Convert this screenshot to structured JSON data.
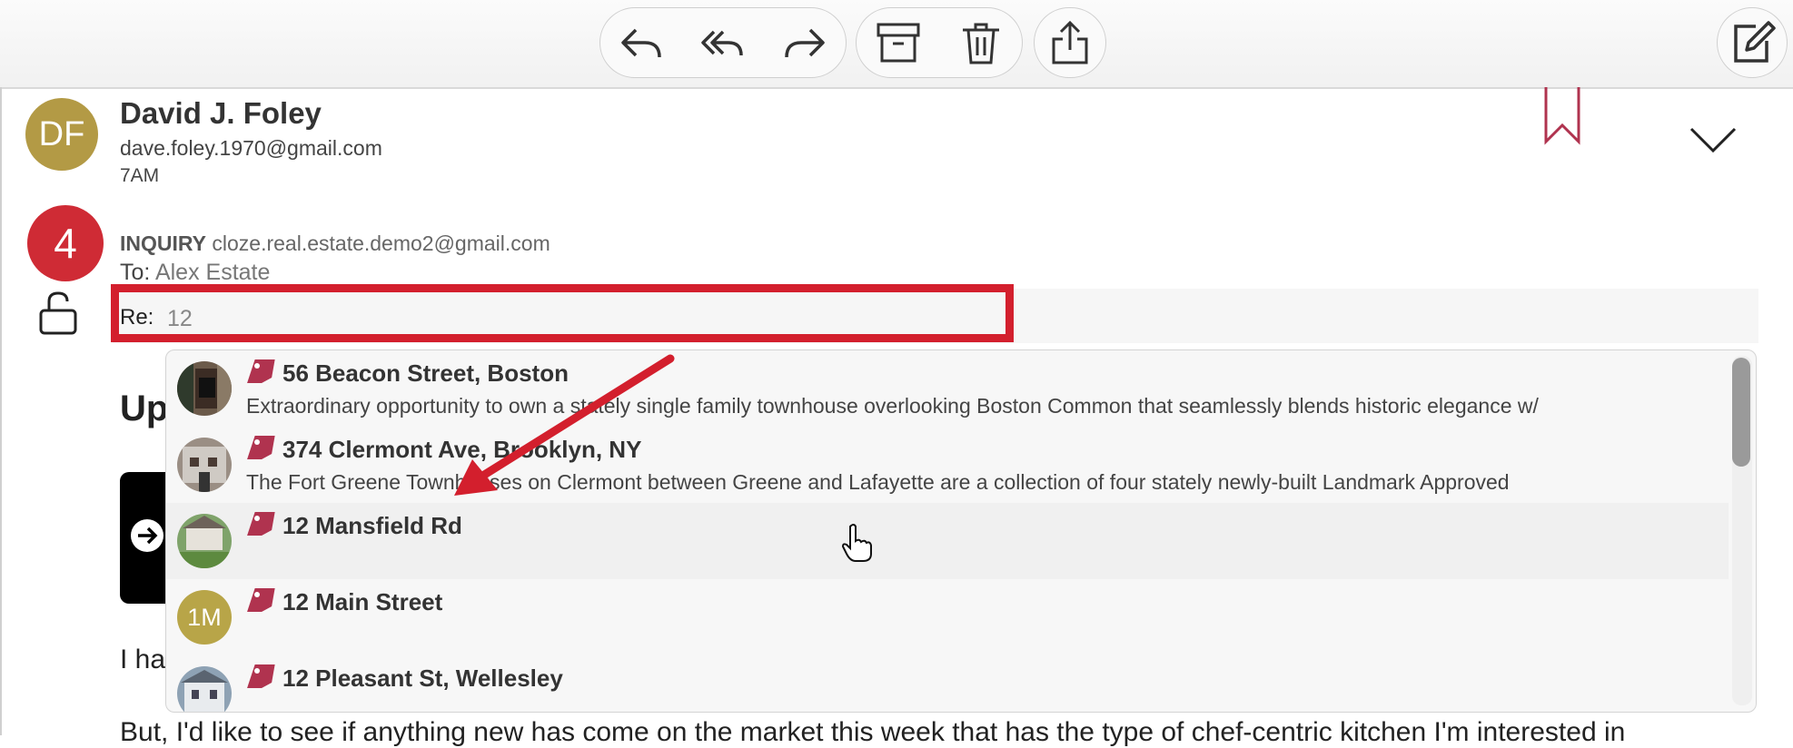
{
  "toolbar": {
    "buttons": [
      "reply-icon",
      "reply-all-icon",
      "forward-icon",
      "archive-icon",
      "trash-icon",
      "share-icon",
      "compose-icon"
    ]
  },
  "email": {
    "sender_initials": "DF",
    "sender_name": "David J. Foley",
    "sender_email": "dave.foley.1970@gmail.com",
    "time": "7AM",
    "badge_count": "4",
    "category": "INQUIRY",
    "from_email": "cloze.real.estate.demo2@gmail.com",
    "to_label": "To:",
    "to_name": "Alex Estate",
    "re_label": "Re:",
    "re_value": "12"
  },
  "background": {
    "heading_fragment": "Up",
    "para1_fragment": "I ha",
    "para2_fragment": "But, I'd like to see if anything new has come on the market this week that has the type of chef-centric kitchen I'm interested in"
  },
  "suggestions": [
    {
      "title": "56 Beacon Street, Boston",
      "desc": "Extraordinary opportunity to own a stately single family townhouse overlooking Boston Common that seamlessly blends historic elegance w/",
      "thumb": "photo"
    },
    {
      "title": "374 Clermont Ave, Brooklyn, NY",
      "desc": "The Fort Greene Townhouses on Clermont between Greene and Lafayette are a collection of four stately newly-built Landmark Approved",
      "thumb": "photo"
    },
    {
      "title": "12 Mansfield Rd",
      "desc": "",
      "thumb": "photo"
    },
    {
      "title": "12 Main Street",
      "desc": "",
      "thumb": "initials",
      "initials": "1M"
    },
    {
      "title": "12 Pleasant St, Wellesley",
      "desc": "",
      "thumb": "photo"
    }
  ],
  "colors": {
    "accent_red": "#d31f2d",
    "tag_color": "#b0334f",
    "avatar_gold": "#b39a45"
  }
}
